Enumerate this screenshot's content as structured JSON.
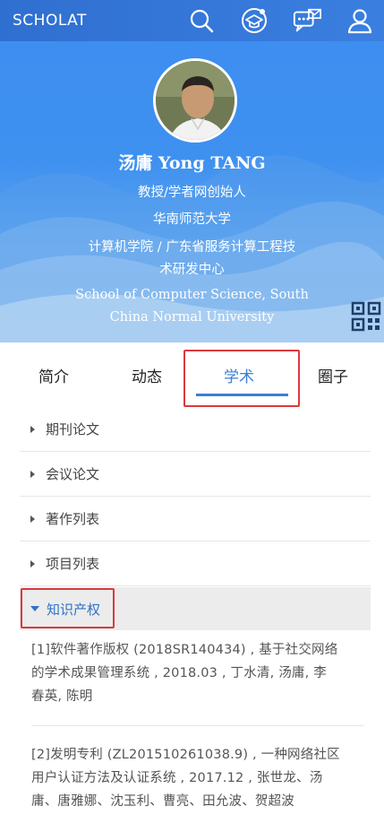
{
  "header": {
    "brand": "SCHOLAT",
    "icons": [
      "search-icon",
      "graduation-cap-icon",
      "messages-icon",
      "user-icon"
    ],
    "accent_color": "#3a7fe0"
  },
  "profile": {
    "name": "汤庸 Yong TANG",
    "title": "教授/学者网创始人",
    "university": "华南师范大学",
    "school_line1": "计算机学院 / 广东省服务计算工程技",
    "school_line2": "术研发中心",
    "english_line1": "School of Computer Science, South",
    "english_line2": "China Normal University",
    "qr_icon": "qr-code-icon"
  },
  "tabs": [
    {
      "label": "简介"
    },
    {
      "label": "动态"
    },
    {
      "label": "学术",
      "active": true
    },
    {
      "label": "圈子"
    }
  ],
  "sections": [
    {
      "label": "期刊论文"
    },
    {
      "label": "会议论文"
    },
    {
      "label": "著作列表"
    },
    {
      "label": "项目列表"
    },
    {
      "label": "知识产权",
      "expanded": true
    }
  ],
  "entries": [
    {
      "line1": "[1]软件著作版权 (2018SR140434) , 基于社交网络",
      "line2": "的学术成果管理系统 , 2018.03 , 丁水清, 汤庸, 李",
      "line3": "春英, 陈明"
    },
    {
      "line1": "[2]发明专利 (ZL201510261038.9) , 一种网络社区",
      "line2": "用户认证方法及认证系统 , 2017.12 , 张世龙、汤",
      "line3": "庸、唐雅娜、沈玉利、曹亮、田允波、贺超波"
    }
  ],
  "highlight_color": "#d9393e"
}
